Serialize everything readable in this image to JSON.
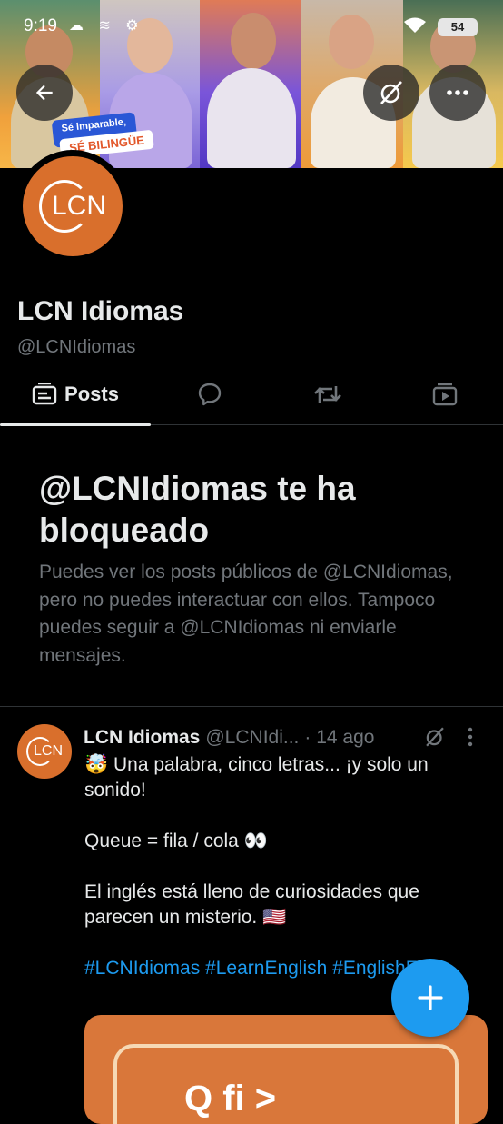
{
  "status_bar": {
    "time": "9:19",
    "battery": "54"
  },
  "banner": {
    "tag_line1": "Sé imparable,",
    "tag_line2": "SÉ BILINGÜE"
  },
  "profile": {
    "display_name": "LCN Idiomas",
    "handle": "@LCNIdiomas",
    "avatar_text": "LCN"
  },
  "tabs": {
    "posts_label": "Posts"
  },
  "blocked": {
    "title": "@LCNIdiomas te ha bloqueado",
    "description": "Puedes ver los posts públicos de @LCNIdiomas, pero no puedes interactuar con ellos. Tampoco puedes seguir a @LCNIdiomas ni enviarle mensajes."
  },
  "post": {
    "author_name": "LCN Idiomas",
    "author_handle": "@LCNIdi...",
    "time": "· 14 ago",
    "line1": "🤯 Una palabra, cinco letras... ¡y solo un sonido!",
    "line2": "Queue = fila / cola 👀",
    "line3": "El inglés está lleno de curiosidades que parecen un misterio. 🇺🇸",
    "hashtags": "#LCNIdiomas #LearnEnglish #EnglishFacts",
    "media_text": "Q  fi  >"
  },
  "colors": {
    "background": "#000000",
    "text_primary": "#e7e9ea",
    "text_secondary": "#71767b",
    "accent": "#1d9bf0",
    "brand_orange": "#d96f2c",
    "divider": "#2f3336"
  },
  "icons": {
    "back": "arrow-left-icon",
    "grok": "grok-icon",
    "more": "more-horizontal-icon",
    "posts_tab": "posts-icon",
    "replies_tab": "reply-bubble-icon",
    "reposts_tab": "repost-icon",
    "media_tab": "media-icon",
    "fab": "plus-icon"
  }
}
